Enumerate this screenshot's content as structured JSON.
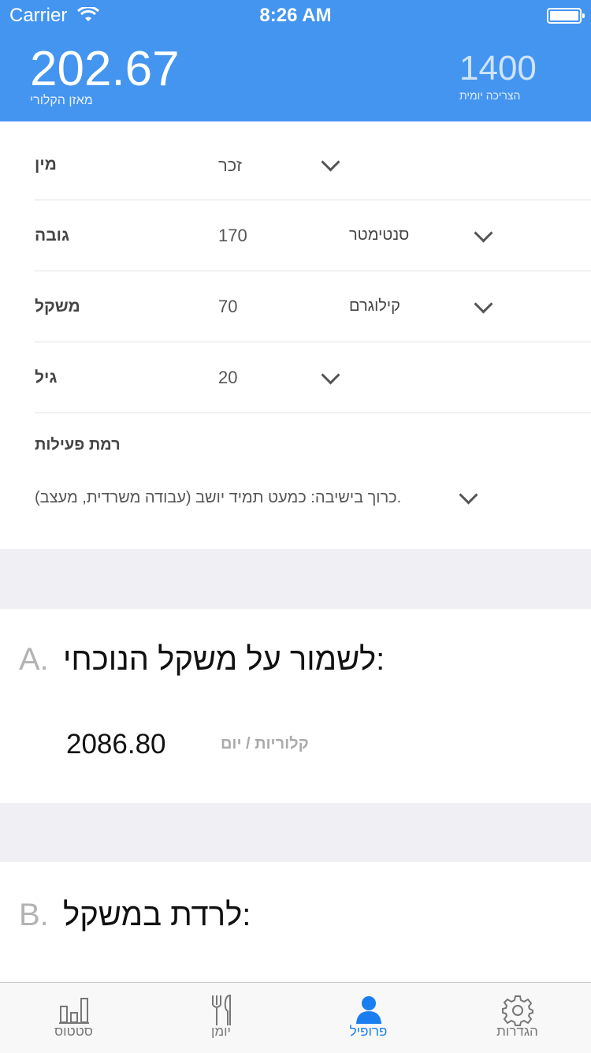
{
  "status_bar": {
    "carrier": "Carrier",
    "time": "8:26 AM"
  },
  "header": {
    "balance_value": "202.67",
    "balance_label": "מאזן הקלורי",
    "daily_value": "1400",
    "daily_label": "הצריכה יומית",
    "background_color": "#4495f0"
  },
  "profile": {
    "gender": {
      "label": "מין",
      "value": "זכר"
    },
    "height": {
      "label": "גובה",
      "value": "170",
      "unit": "סנטימטר"
    },
    "weight": {
      "label": "משקל",
      "value": "70",
      "unit": "קילוגרם"
    },
    "age": {
      "label": "גיל",
      "value": "20"
    },
    "activity": {
      "label": "רמת פעילות",
      "value": "(כרוך בישיבה: כמעט תמיד יושב (עבודה משרדית, מעצב."
    }
  },
  "section_a": {
    "letter": "A.",
    "title": "לשמור על משקל הנוכחי:",
    "value": "2086.80",
    "unit": "קלוריות / יום"
  },
  "section_b": {
    "letter": "B.",
    "title": "לרדת במשקל:"
  },
  "tabs": [
    {
      "label": "סטטוס",
      "icon": "bar-chart-icon",
      "active": false
    },
    {
      "label": "יומן",
      "icon": "fork-knife-icon",
      "active": false
    },
    {
      "label": "פרופיל",
      "icon": "person-icon",
      "active": true
    },
    {
      "label": "הגדרות",
      "icon": "gear-icon",
      "active": false
    }
  ],
  "colors": {
    "accent": "#1a7ef0",
    "inactive": "#777777"
  }
}
